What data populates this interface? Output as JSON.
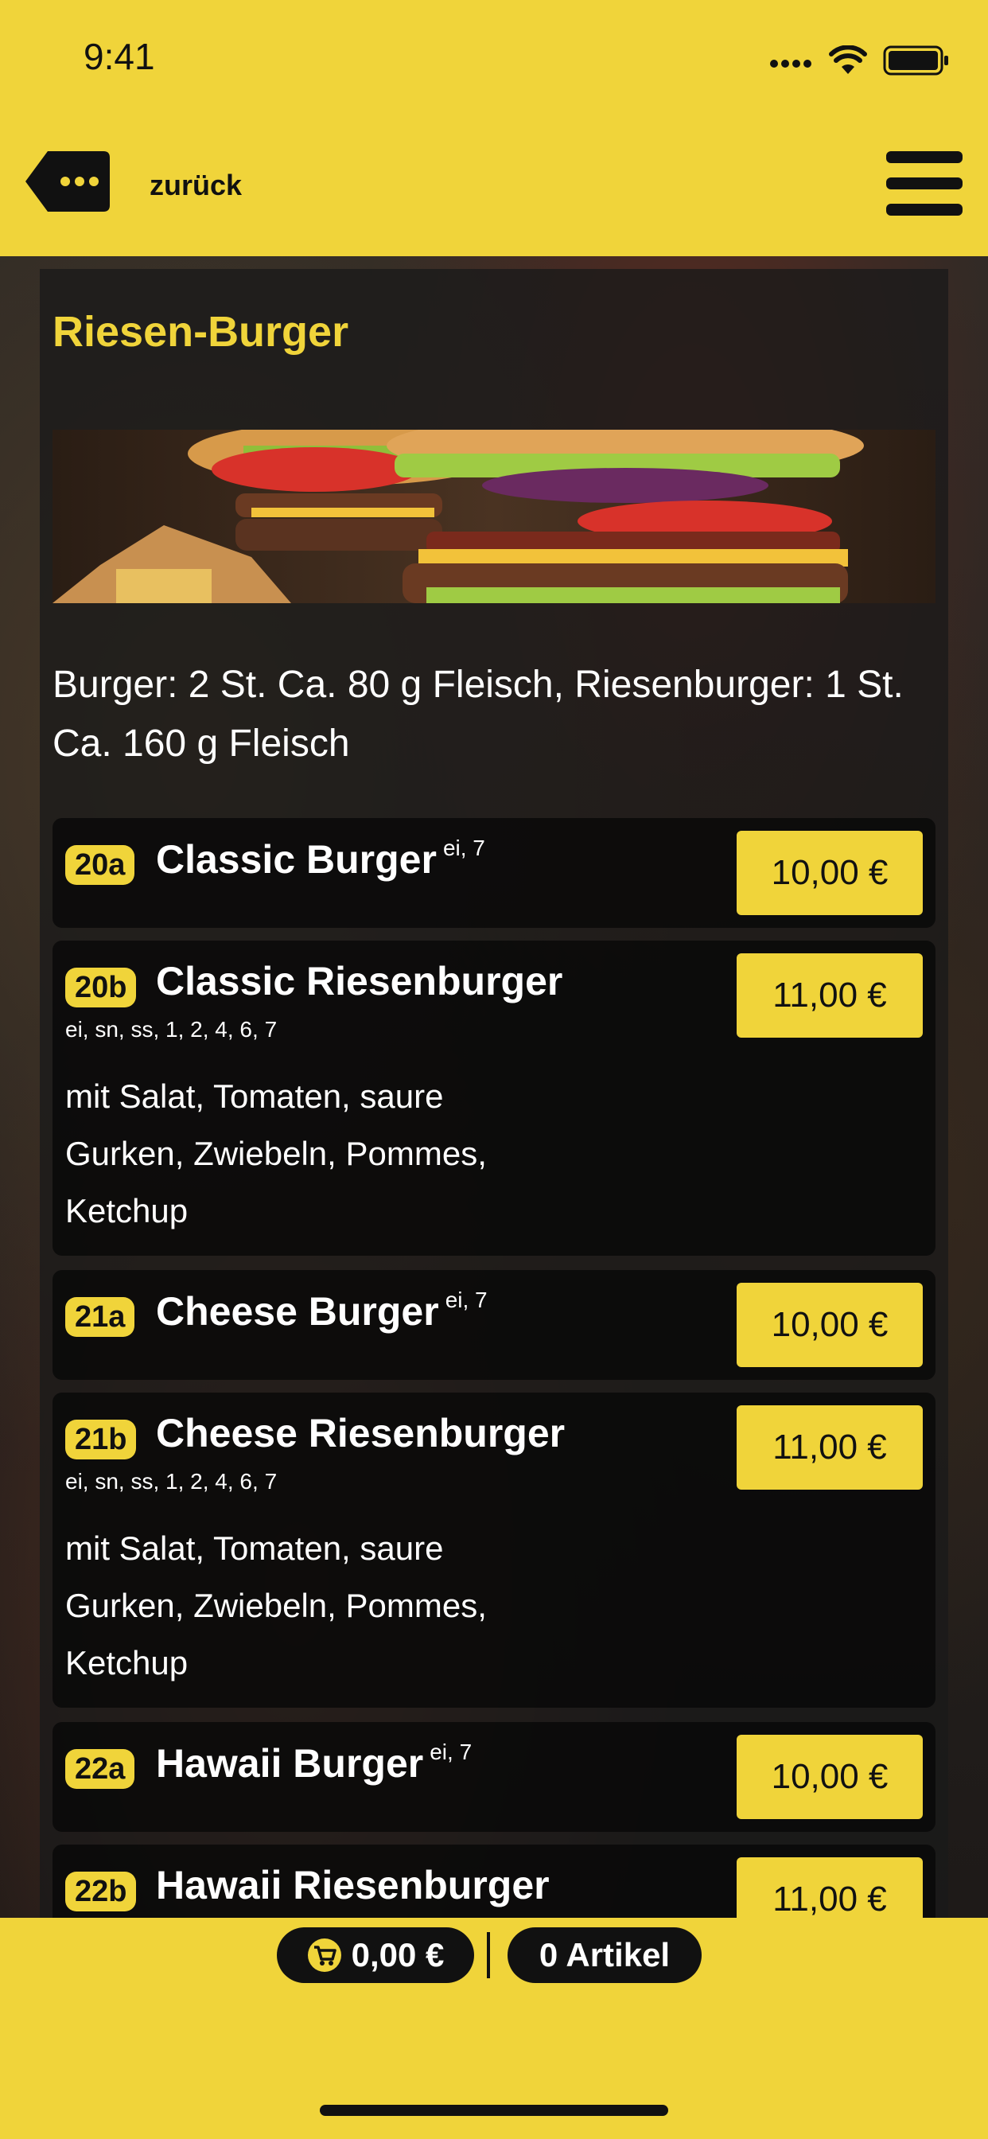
{
  "status": {
    "time": "9:41"
  },
  "nav": {
    "back_label": "zurück"
  },
  "category": {
    "title": "Riesen-Burger",
    "description": "Burger: 2 St. Ca. 80 g Fleisch, Riesenburger: 1 St. Ca. 160 g Fleisch"
  },
  "items": [
    {
      "code": "20a",
      "name": "Classic Burger",
      "superscript": "ei, 7",
      "allergens": "",
      "description": "",
      "price": "10,00 €"
    },
    {
      "code": "20b",
      "name": "Classic Riesenburger",
      "superscript": "",
      "allergens": "ei, sn, ss, 1, 2, 4, 6, 7",
      "description": "mit Salat, Tomaten, saure Gurken, Zwiebeln, Pommes, Ketchup",
      "price": "11,00 €"
    },
    {
      "code": "21a",
      "name": "Cheese Burger",
      "superscript": "ei, 7",
      "allergens": "",
      "description": "",
      "price": "10,00 €"
    },
    {
      "code": "21b",
      "name": "Cheese Riesenburger",
      "superscript": "",
      "allergens": "ei, sn, ss, 1, 2, 4, 6, 7",
      "description": "mit Salat, Tomaten, saure Gurken, Zwiebeln, Pommes, Ketchup",
      "price": "11,00 €"
    },
    {
      "code": "22a",
      "name": "Hawaii Burger",
      "superscript": "ei, 7",
      "allergens": "",
      "description": "",
      "price": "10,00 €"
    },
    {
      "code": "22b",
      "name": "Hawaii Riesenburger",
      "superscript": "",
      "allergens": "",
      "description": "",
      "price": "11,00 €"
    }
  ],
  "cart": {
    "total": "0,00 €",
    "count": "0 Artikel"
  },
  "colors": {
    "accent": "#f0d43a",
    "dark": "#111111"
  }
}
